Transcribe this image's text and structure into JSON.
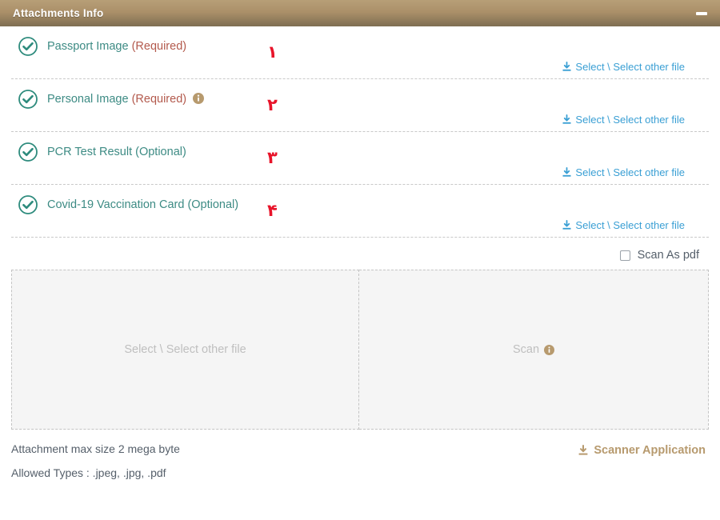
{
  "header": {
    "title": "Attachments Info",
    "minimize_label": "−"
  },
  "colors": {
    "header_gradient_top": "#b79f77",
    "header_gradient_bottom": "#7e6e52",
    "label_teal": "#3d8b84",
    "required_red": "#b35a4d",
    "number_red": "#e8142a",
    "link_blue": "#3a9fd4",
    "tan": "#b79a6e",
    "dropzone_bg": "#f5f5f5",
    "placeholder_gray": "#bfbfbf"
  },
  "rows": [
    {
      "check_icon": "circle-check-icon",
      "label": "Passport Image",
      "requirement": "(Required)",
      "requirement_type": "required",
      "has_info_icon": false,
      "number": "۱",
      "select_label": "Select \\ Select other file",
      "select_icon": "download-icon"
    },
    {
      "check_icon": "circle-check-icon",
      "label": "Personal Image",
      "requirement": "(Required)",
      "requirement_type": "required",
      "has_info_icon": true,
      "number": "۲",
      "select_label": "Select \\ Select other file",
      "select_icon": "download-icon"
    },
    {
      "check_icon": "circle-check-icon",
      "label": "PCR Test Result",
      "requirement": "(Optional)",
      "requirement_type": "optional",
      "has_info_icon": false,
      "number": "۳",
      "select_label": "Select \\ Select other file",
      "select_icon": "download-icon"
    },
    {
      "check_icon": "circle-check-icon",
      "label": "Covid-19 Vaccination Card",
      "requirement": "(Optional)",
      "requirement_type": "optional",
      "has_info_icon": false,
      "number": "۴",
      "select_label": "Select \\ Select other file",
      "select_icon": "download-icon"
    }
  ],
  "scan_as_pdf": {
    "label": "Scan As pdf",
    "checked": false
  },
  "dropzones": {
    "left": {
      "label": "Select \\ Select other file"
    },
    "right": {
      "label": "Scan",
      "info_icon": "info-icon"
    }
  },
  "footer": {
    "max_size_note": "Attachment max size 2 mega byte",
    "allowed_types_note": "Allowed Types : .jpeg, .jpg, .pdf",
    "scanner_app_label": "Scanner Application",
    "scanner_app_icon": "download-icon"
  }
}
